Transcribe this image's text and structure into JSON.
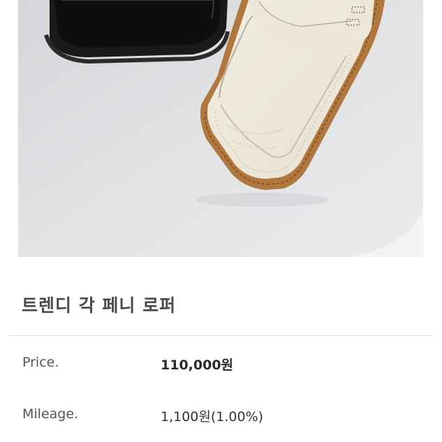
{
  "product": {
    "title": "트렌디 각 페니 로퍼",
    "image": {
      "subject": "black-and-cream-square-toe-penny-loafers"
    }
  },
  "info": {
    "price": {
      "label": "Price.",
      "value": "110,000원"
    },
    "mileage": {
      "label": "Mileage.",
      "value": "1,100원(1.00%)"
    }
  },
  "colors": {
    "title": "#4a4a4a",
    "label": "#555555",
    "value": "#333333",
    "divider": "#dedede",
    "photo_background": "#e3e4e6"
  }
}
